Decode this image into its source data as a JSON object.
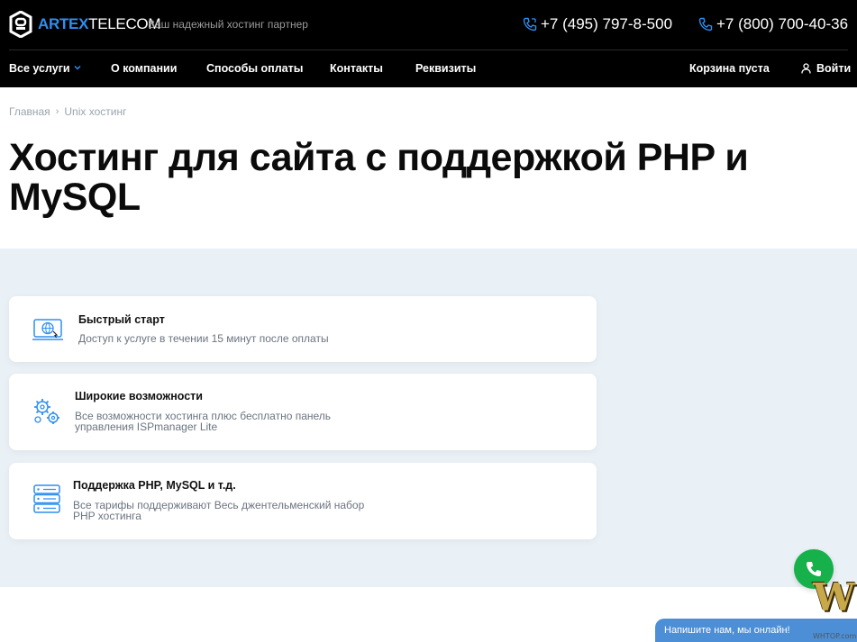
{
  "header": {
    "logo": {
      "part1": "ARTEX",
      "part2": "TELECOM"
    },
    "tagline": "Ваш надежный хостинг партнер",
    "phones": [
      "+7 (495) 797-8-500",
      "+7 (800) 700-40-36"
    ],
    "nav": [
      {
        "label": "Все услуги",
        "has_dropdown": true
      },
      {
        "label": "О компании"
      },
      {
        "label": "Способы оплаты"
      },
      {
        "label": "Контакты"
      },
      {
        "label": "Реквизиты"
      }
    ],
    "cart": "Корзина пуста",
    "login": "Войти"
  },
  "breadcrumb": [
    "Главная",
    "Unix хостинг"
  ],
  "page_title": "Хостинг для сайта с поддержкой PHP и MySQL",
  "features": [
    {
      "icon": "laptop-globe-icon",
      "title": "Быстрый старт",
      "desc": "Доступ к услуге в течении 15 минут после оплаты"
    },
    {
      "icon": "gears-icon",
      "title": "Широкие возможности",
      "desc": "Все возможности хостинга плюс бесплатно панель управления ISPmanager Lite"
    },
    {
      "icon": "server-rack-icon",
      "title": "Поддержка PHP, MySQL и т.д.",
      "desc": "Все тарифы поддерживают Весь джентельменский набор PHP хостинга"
    }
  ],
  "chat": {
    "label": "Напишите нам, мы онлайн!"
  },
  "colors": {
    "accent": "#2f8ff0",
    "header_bg": "#000000",
    "section_bg": "#eaf1f6",
    "call_green": "#16b14a",
    "chat_blue": "#4d8fd6"
  },
  "watermark": {
    "text": "W",
    "url": "WHTOP.com"
  }
}
